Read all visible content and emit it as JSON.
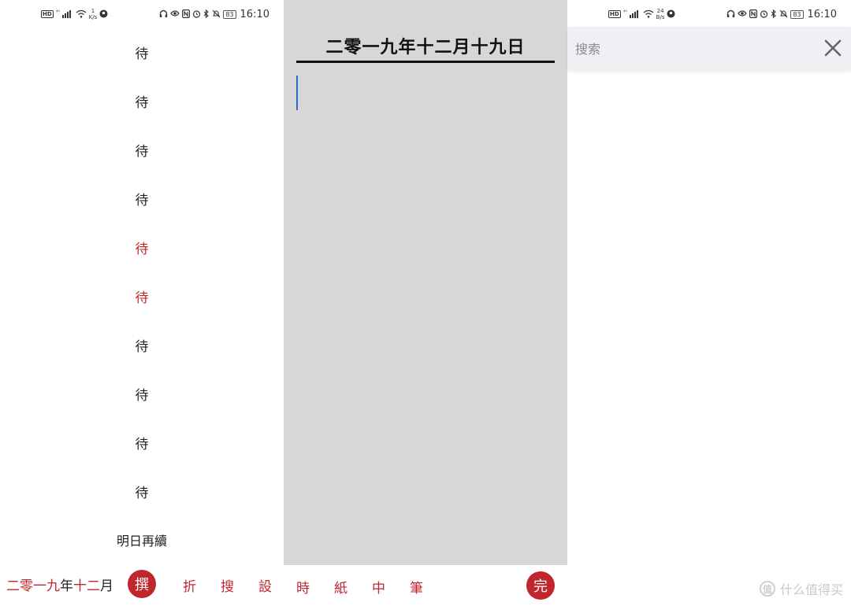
{
  "status_bar_left": {
    "network": "⁴ᴳ",
    "speed_value": "1",
    "speed_unit": "K/s",
    "time": "16:10",
    "battery": "83"
  },
  "status_bar_right": {
    "network": "⁴ᴳ",
    "speed_value": "24",
    "speed_unit": "B/s",
    "time": "16:10",
    "battery": "83"
  },
  "list_panel": {
    "items": [
      {
        "label": "待",
        "color": "#222222"
      },
      {
        "label": "待",
        "color": "#222222"
      },
      {
        "label": "待",
        "color": "#222222"
      },
      {
        "label": "待",
        "color": "#222222"
      },
      {
        "label": "待",
        "color": "#c0272d"
      },
      {
        "label": "待",
        "color": "#c0272d"
      },
      {
        "label": "待",
        "color": "#222222"
      },
      {
        "label": "待",
        "color": "#222222"
      },
      {
        "label": "待",
        "color": "#222222"
      },
      {
        "label": "待",
        "color": "#222222"
      }
    ],
    "footer_label": "明日再續"
  },
  "editor_panel": {
    "title": "二零一九年十二月十九日"
  },
  "search_panel": {
    "placeholder": "搜索",
    "close_icon": "close-x"
  },
  "bottom_bar": {
    "date_red": "二零一九",
    "date_black_1": "年",
    "date_red_2": "十二",
    "date_black_2": "月",
    "select_button": "撰",
    "tools": [
      "折",
      "搜",
      "設",
      "時",
      "紙",
      "中",
      "筆"
    ],
    "done_button": "完",
    "watermark_badge": "值",
    "watermark_text": "什么值得买"
  },
  "colors": {
    "accent_red": "#c0272d",
    "editor_bg": "#d7d7d7",
    "cursor_blue": "#2a6dc4",
    "search_bar_bg": "#f0f0f4"
  }
}
